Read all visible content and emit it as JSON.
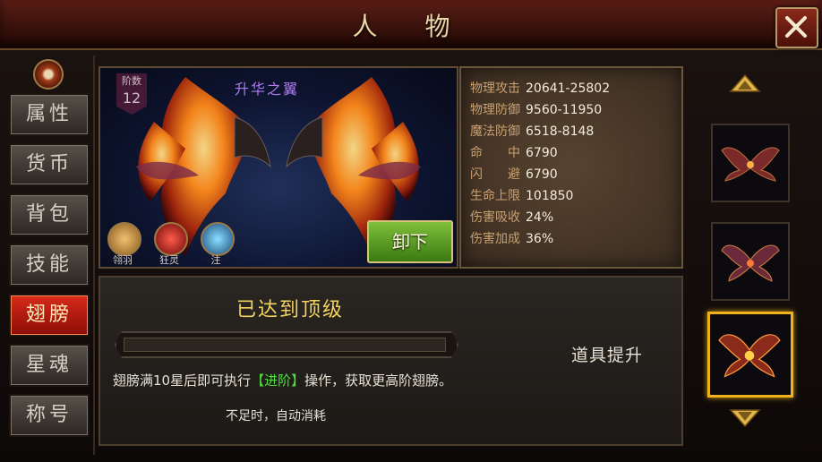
{
  "window": {
    "title": "人 物"
  },
  "nav": {
    "items": [
      {
        "label": "属性",
        "active": false
      },
      {
        "label": "货币",
        "active": false
      },
      {
        "label": "背包",
        "active": false
      },
      {
        "label": "技能",
        "active": false
      },
      {
        "label": "翅膀",
        "active": true
      },
      {
        "label": "星魂",
        "active": false
      },
      {
        "label": "称号",
        "active": false
      }
    ]
  },
  "showcase": {
    "rank_label": "阶数",
    "rank_value": "12",
    "wing_name": "升华之翼",
    "skills": [
      {
        "label": "翎羽",
        "icon": "feather-skill-icon"
      },
      {
        "label": "狂灵",
        "icon": "demon-skill-icon"
      },
      {
        "label": "注",
        "icon": "wave-skill-icon"
      }
    ],
    "unequip_label": "卸下"
  },
  "stats": [
    {
      "label": "物理攻击",
      "value": "20641-25802"
    },
    {
      "label": "物理防御",
      "value": "9560-11950"
    },
    {
      "label": "魔法防御",
      "value": "6518-8148"
    },
    {
      "label": "命　　中",
      "value": "6790"
    },
    {
      "label": "闪　　避",
      "value": "6790"
    },
    {
      "label": "生命上限",
      "value": "101850"
    },
    {
      "label": "伤害吸收",
      "value": "24%"
    },
    {
      "label": "伤害加成",
      "value": "36%"
    }
  ],
  "upgrade": {
    "status": "已达到顶级",
    "hint_prefix": "翅膀满10星后即可执行",
    "hint_highlight": "【进阶】",
    "hint_suffix": "操作，获取更高阶翅膀。",
    "auto_consume": "不足时，自动消耗",
    "item_upgrade": "道具提升"
  },
  "colors": {
    "accent": "#f0b21a",
    "highlight_green": "#4be03a",
    "title_gold": "#f2d35c",
    "active_tab": "#c01a10"
  }
}
